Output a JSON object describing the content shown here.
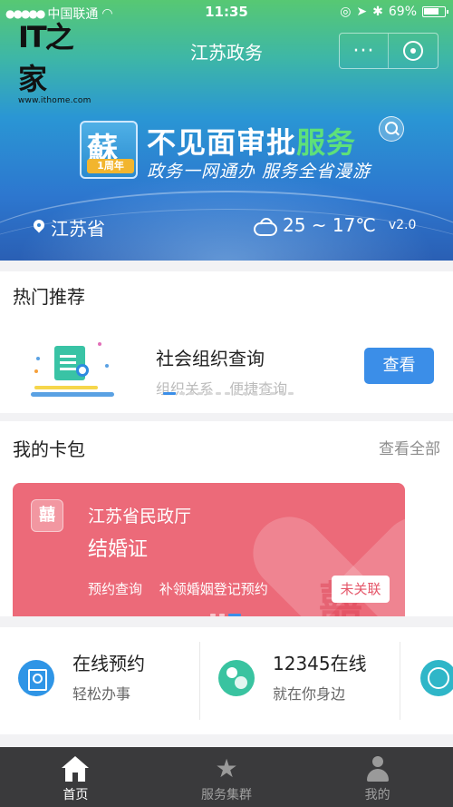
{
  "status_bar": {
    "carrier": "中国联通",
    "time": "11:35",
    "battery": "69%"
  },
  "watermark": {
    "logo_text": "IT之家",
    "url": "www.ithome.com"
  },
  "header": {
    "title": "江苏政务",
    "more_label": "···"
  },
  "banner": {
    "badge_char": "蘇",
    "badge_label": "1周年",
    "slogan_main": "不见面审批",
    "slogan_highlight": "服务",
    "slogan_sub": "政务一网通办 服务全省漫游",
    "location": "江苏省",
    "weather": "25 ~ 17℃",
    "version": "v2.0"
  },
  "hot": {
    "title": "热门推荐",
    "item_name": "社会组织查询",
    "tags": [
      "组织关系",
      "便捷查询"
    ],
    "button": "查看"
  },
  "wallet": {
    "title": "我的卡包",
    "view_all": "查看全部",
    "card": {
      "icon_char": "囍",
      "department": "江苏省民政厅",
      "name": "结婚证",
      "links": [
        "预约查询",
        "补领婚姻登记预约"
      ],
      "status": "未关联",
      "watermark_char": "囍"
    }
  },
  "services": [
    {
      "title": "在线预约",
      "subtitle": "轻松办事",
      "icon": "calendar-book-icon"
    },
    {
      "title": "12345在线",
      "subtitle": "就在你身边",
      "icon": "hotline-icon"
    }
  ],
  "tabs": [
    {
      "label": "首页",
      "icon": "home-icon",
      "active": true
    },
    {
      "label": "服务集群",
      "icon": "star-icon",
      "active": false
    },
    {
      "label": "我的",
      "icon": "user-icon",
      "active": false
    }
  ],
  "colors": {
    "primary_blue": "#3b8ee8",
    "card_red": "#ec6a79",
    "tabbar_bg": "#3a3a3c"
  }
}
